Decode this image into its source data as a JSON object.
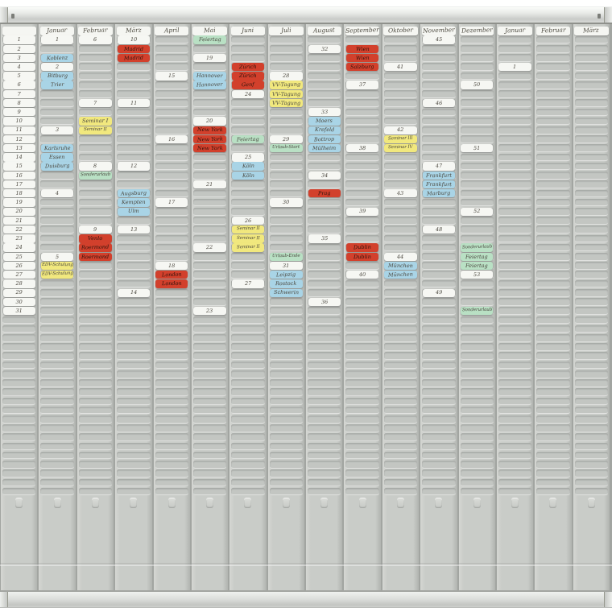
{
  "board": {
    "palette": {
      "white": "#f6f7f3",
      "blue": "#a9d4e6",
      "red": "#d2402c",
      "yellow": "#f1e87e",
      "green": "#b9e0c4"
    },
    "index_numbers": [
      "1",
      "2",
      "3",
      "4",
      "5",
      "6",
      "7",
      "8",
      "9",
      "10",
      "11",
      "12",
      "13",
      "14",
      "15",
      "16",
      "17",
      "18",
      "19",
      "20",
      "21",
      "22",
      "23",
      "24",
      "25",
      "26",
      "27",
      "28",
      "29",
      "30",
      "31"
    ],
    "months": [
      {
        "name": "Januar",
        "cards": [
          {
            "row": 1,
            "color": "white",
            "label": "1"
          },
          {
            "row": 3,
            "color": "blue",
            "label": "Koblenz"
          },
          {
            "row": 4,
            "color": "white",
            "label": "2"
          },
          {
            "row": 5,
            "color": "blue",
            "label": "Bitburg"
          },
          {
            "row": 6,
            "color": "blue",
            "label": "Trier"
          },
          {
            "row": 11,
            "color": "white",
            "label": "3"
          },
          {
            "row": 13,
            "color": "blue",
            "label": "Karlsruhe"
          },
          {
            "row": 14,
            "color": "blue",
            "label": "Essen"
          },
          {
            "row": 15,
            "color": "blue",
            "label": "Duisburg"
          },
          {
            "row": 18,
            "color": "white",
            "label": "4"
          },
          {
            "row": 25,
            "color": "white",
            "label": "5"
          },
          {
            "row": 26,
            "color": "yellow",
            "label": "EDV-Schulung"
          },
          {
            "row": 27,
            "color": "yellow",
            "label": "EDV-Schulung"
          }
        ]
      },
      {
        "name": "Februar",
        "cards": [
          {
            "row": 1,
            "color": "white",
            "label": "6"
          },
          {
            "row": 8,
            "color": "white",
            "label": "7"
          },
          {
            "row": 10,
            "color": "yellow",
            "label": "Seminar I"
          },
          {
            "row": 11,
            "color": "yellow",
            "label": "Seminar II"
          },
          {
            "row": 15,
            "color": "white",
            "label": "8"
          },
          {
            "row": 16,
            "color": "green",
            "label": "Sonderurlaub"
          },
          {
            "row": 22,
            "color": "white",
            "label": "9"
          },
          {
            "row": 23,
            "color": "red",
            "label": "Venlo"
          },
          {
            "row": 24,
            "color": "red",
            "label": "Roermond"
          },
          {
            "row": 25,
            "color": "red",
            "label": "Roermond"
          }
        ]
      },
      {
        "name": "März",
        "cards": [
          {
            "row": 1,
            "color": "white",
            "label": "10"
          },
          {
            "row": 2,
            "color": "red",
            "label": "Madrid"
          },
          {
            "row": 3,
            "color": "red",
            "label": "Madrid"
          },
          {
            "row": 8,
            "color": "white",
            "label": "11"
          },
          {
            "row": 15,
            "color": "white",
            "label": "12"
          },
          {
            "row": 18,
            "color": "blue",
            "label": "Augsburg"
          },
          {
            "row": 19,
            "color": "blue",
            "label": "Kempten"
          },
          {
            "row": 20,
            "color": "blue",
            "label": "Ulm"
          },
          {
            "row": 22,
            "color": "white",
            "label": "13"
          },
          {
            "row": 29,
            "color": "white",
            "label": "14"
          }
        ]
      },
      {
        "name": "April",
        "cards": [
          {
            "row": 5,
            "color": "white",
            "label": "15"
          },
          {
            "row": 12,
            "color": "white",
            "label": "16"
          },
          {
            "row": 19,
            "color": "white",
            "label": "17"
          },
          {
            "row": 26,
            "color": "white",
            "label": "18"
          },
          {
            "row": 27,
            "color": "red",
            "label": "London"
          },
          {
            "row": 28,
            "color": "red",
            "label": "London"
          }
        ]
      },
      {
        "name": "Mai",
        "cards": [
          {
            "row": 1,
            "color": "green",
            "label": "Feiertag"
          },
          {
            "row": 3,
            "color": "white",
            "label": "19"
          },
          {
            "row": 5,
            "color": "blue",
            "label": "Hannover"
          },
          {
            "row": 6,
            "color": "blue",
            "label": "Hannover"
          },
          {
            "row": 10,
            "color": "white",
            "label": "20"
          },
          {
            "row": 11,
            "color": "red",
            "label": "New York"
          },
          {
            "row": 12,
            "color": "red",
            "label": "New York"
          },
          {
            "row": 13,
            "color": "red",
            "label": "New York"
          },
          {
            "row": 17,
            "color": "white",
            "label": "21"
          },
          {
            "row": 24,
            "color": "white",
            "label": "22"
          },
          {
            "row": 31,
            "color": "white",
            "label": "23"
          }
        ]
      },
      {
        "name": "Juni",
        "cards": [
          {
            "row": 4,
            "color": "red",
            "label": "Zürich"
          },
          {
            "row": 5,
            "color": "red",
            "label": "Zürich"
          },
          {
            "row": 6,
            "color": "red",
            "label": "Genf"
          },
          {
            "row": 7,
            "color": "white",
            "label": "24"
          },
          {
            "row": 12,
            "color": "green",
            "label": "Feiertag"
          },
          {
            "row": 14,
            "color": "white",
            "label": "25"
          },
          {
            "row": 15,
            "color": "blue",
            "label": "Köln"
          },
          {
            "row": 16,
            "color": "blue",
            "label": "Köln"
          },
          {
            "row": 21,
            "color": "white",
            "label": "26"
          },
          {
            "row": 22,
            "color": "yellow",
            "label": "Seminar II"
          },
          {
            "row": 23,
            "color": "yellow",
            "label": "Seminar II"
          },
          {
            "row": 24,
            "color": "yellow",
            "label": "Seminar II"
          },
          {
            "row": 28,
            "color": "white",
            "label": "27"
          }
        ]
      },
      {
        "name": "Juli",
        "cards": [
          {
            "row": 5,
            "color": "white",
            "label": "28"
          },
          {
            "row": 6,
            "color": "yellow",
            "label": "VV-Tagung"
          },
          {
            "row": 7,
            "color": "yellow",
            "label": "VV-Tagung"
          },
          {
            "row": 8,
            "color": "yellow",
            "label": "VV-Tagung"
          },
          {
            "row": 12,
            "color": "white",
            "label": "29"
          },
          {
            "row": 13,
            "color": "green",
            "label": "Urlaub-Start"
          },
          {
            "row": 19,
            "color": "white",
            "label": "30"
          },
          {
            "row": 25,
            "color": "green",
            "label": "Urlaub-Ende"
          },
          {
            "row": 26,
            "color": "white",
            "label": "31"
          },
          {
            "row": 27,
            "color": "blue",
            "label": "Leipzig"
          },
          {
            "row": 28,
            "color": "blue",
            "label": "Rostock"
          },
          {
            "row": 29,
            "color": "blue",
            "label": "Schwerin"
          }
        ]
      },
      {
        "name": "August",
        "cards": [
          {
            "row": 2,
            "color": "white",
            "label": "32"
          },
          {
            "row": 9,
            "color": "white",
            "label": "33"
          },
          {
            "row": 10,
            "color": "blue",
            "label": "Moers"
          },
          {
            "row": 11,
            "color": "blue",
            "label": "Krefeld"
          },
          {
            "row": 12,
            "color": "blue",
            "label": "Bottrop"
          },
          {
            "row": 13,
            "color": "blue",
            "label": "Mülheim"
          },
          {
            "row": 16,
            "color": "white",
            "label": "34"
          },
          {
            "row": 18,
            "color": "red",
            "label": "Prag"
          },
          {
            "row": 23,
            "color": "white",
            "label": "35"
          },
          {
            "row": 30,
            "color": "white",
            "label": "36"
          }
        ]
      },
      {
        "name": "September",
        "cards": [
          {
            "row": 2,
            "color": "red",
            "label": "Wien"
          },
          {
            "row": 3,
            "color": "red",
            "label": "Wien"
          },
          {
            "row": 4,
            "color": "red",
            "label": "Salzburg"
          },
          {
            "row": 6,
            "color": "white",
            "label": "37"
          },
          {
            "row": 13,
            "color": "white",
            "label": "38"
          },
          {
            "row": 20,
            "color": "white",
            "label": "39"
          },
          {
            "row": 24,
            "color": "red",
            "label": "Dublin"
          },
          {
            "row": 25,
            "color": "red",
            "label": "Dublin"
          },
          {
            "row": 27,
            "color": "white",
            "label": "40"
          }
        ]
      },
      {
        "name": "Oktober",
        "cards": [
          {
            "row": 4,
            "color": "white",
            "label": "41"
          },
          {
            "row": 11,
            "color": "white",
            "label": "42"
          },
          {
            "row": 12,
            "color": "yellow",
            "label": "Seminar III"
          },
          {
            "row": 13,
            "color": "yellow",
            "label": "Seminar IV"
          },
          {
            "row": 18,
            "color": "white",
            "label": "43"
          },
          {
            "row": 25,
            "color": "white",
            "label": "44"
          },
          {
            "row": 26,
            "color": "blue",
            "label": "München"
          },
          {
            "row": 27,
            "color": "blue",
            "label": "München"
          }
        ]
      },
      {
        "name": "November",
        "cards": [
          {
            "row": 1,
            "color": "white",
            "label": "45"
          },
          {
            "row": 8,
            "color": "white",
            "label": "46"
          },
          {
            "row": 15,
            "color": "white",
            "label": "47"
          },
          {
            "row": 16,
            "color": "blue",
            "label": "Frankfurt"
          },
          {
            "row": 17,
            "color": "blue",
            "label": "Frankfurt"
          },
          {
            "row": 18,
            "color": "blue",
            "label": "Marburg"
          },
          {
            "row": 22,
            "color": "white",
            "label": "48"
          },
          {
            "row": 29,
            "color": "white",
            "label": "49"
          }
        ]
      },
      {
        "name": "Dezember",
        "cards": [
          {
            "row": 6,
            "color": "white",
            "label": "50"
          },
          {
            "row": 13,
            "color": "white",
            "label": "51"
          },
          {
            "row": 20,
            "color": "white",
            "label": "52"
          },
          {
            "row": 24,
            "color": "green",
            "label": "Sonderurlaub"
          },
          {
            "row": 25,
            "color": "green",
            "label": "Feiertag"
          },
          {
            "row": 26,
            "color": "green",
            "label": "Feiertag"
          },
          {
            "row": 27,
            "color": "white",
            "label": "53"
          },
          {
            "row": 31,
            "color": "green",
            "label": "Sonderurlaub"
          }
        ]
      },
      {
        "name": "Januar",
        "cards": [
          {
            "row": 4,
            "color": "white",
            "label": "1"
          }
        ]
      },
      {
        "name": "Februar",
        "cards": []
      },
      {
        "name": "März",
        "cards": []
      }
    ]
  }
}
